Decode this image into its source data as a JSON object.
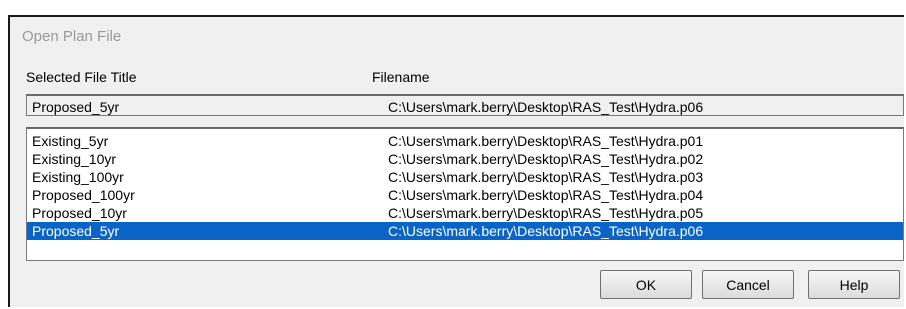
{
  "window": {
    "title": "Open Plan File"
  },
  "columns": {
    "title": "Selected File Title",
    "filename": "Filename"
  },
  "selected": {
    "title": "Proposed_5yr",
    "filename": "C:\\Users\\mark.berry\\Desktop\\RAS_Test\\Hydra.p06"
  },
  "plans": [
    {
      "title": "Existing_5yr",
      "filename": "C:\\Users\\mark.berry\\Desktop\\RAS_Test\\Hydra.p01"
    },
    {
      "title": "Existing_10yr",
      "filename": "C:\\Users\\mark.berry\\Desktop\\RAS_Test\\Hydra.p02"
    },
    {
      "title": "Existing_100yr",
      "filename": "C:\\Users\\mark.berry\\Desktop\\RAS_Test\\Hydra.p03"
    },
    {
      "title": "Proposed_100yr",
      "filename": "C:\\Users\\mark.berry\\Desktop\\RAS_Test\\Hydra.p04"
    },
    {
      "title": "Proposed_10yr",
      "filename": "C:\\Users\\mark.berry\\Desktop\\RAS_Test\\Hydra.p05"
    },
    {
      "title": "Proposed_5yr",
      "filename": "C:\\Users\\mark.berry\\Desktop\\RAS_Test\\Hydra.p06"
    }
  ],
  "selected_index": 5,
  "buttons": {
    "ok": "OK",
    "cancel": "Cancel",
    "help": "Help"
  },
  "colors": {
    "selection": "#0a64c8",
    "dialog_bg": "#f0f0f0"
  }
}
